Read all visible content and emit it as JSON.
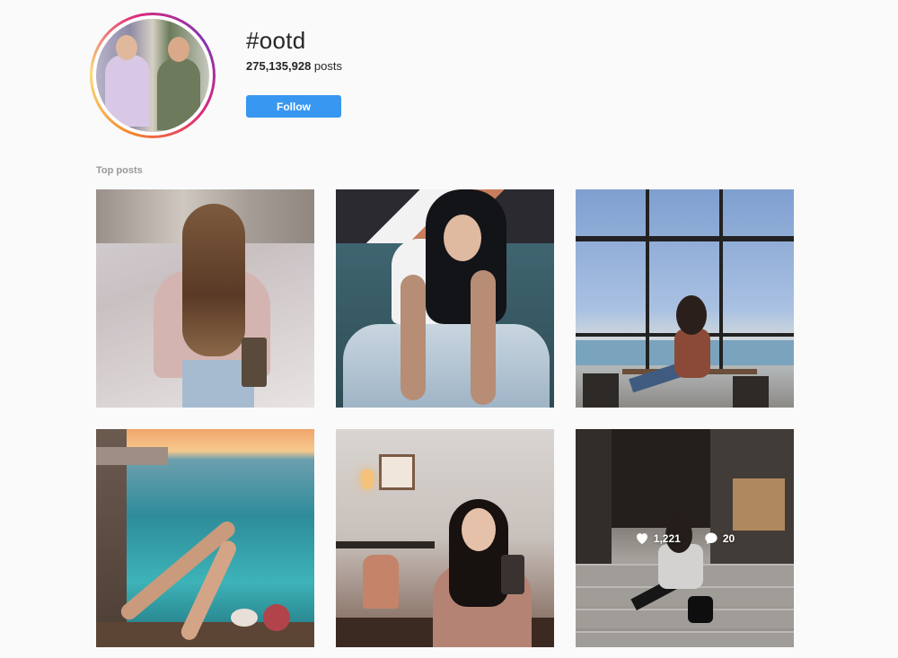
{
  "hashtag": {
    "title": "#ootd",
    "post_count": "275,135,928",
    "post_count_suffix": " posts",
    "follow_label": "Follow"
  },
  "sections": {
    "top_posts_label": "Top posts"
  },
  "posts": [
    {
      "likes": "",
      "comments": ""
    },
    {
      "likes": "",
      "comments": ""
    },
    {
      "likes": "",
      "comments": ""
    },
    {
      "likes": "",
      "comments": ""
    },
    {
      "likes": "",
      "comments": ""
    },
    {
      "likes": "1,221",
      "comments": "20",
      "hovered": true
    }
  ],
  "colors": {
    "follow_button": "#3897f0",
    "background": "#fafafa",
    "section_label": "#999999"
  },
  "icons": {
    "likes": "heart-icon",
    "comments": "comment-icon"
  }
}
